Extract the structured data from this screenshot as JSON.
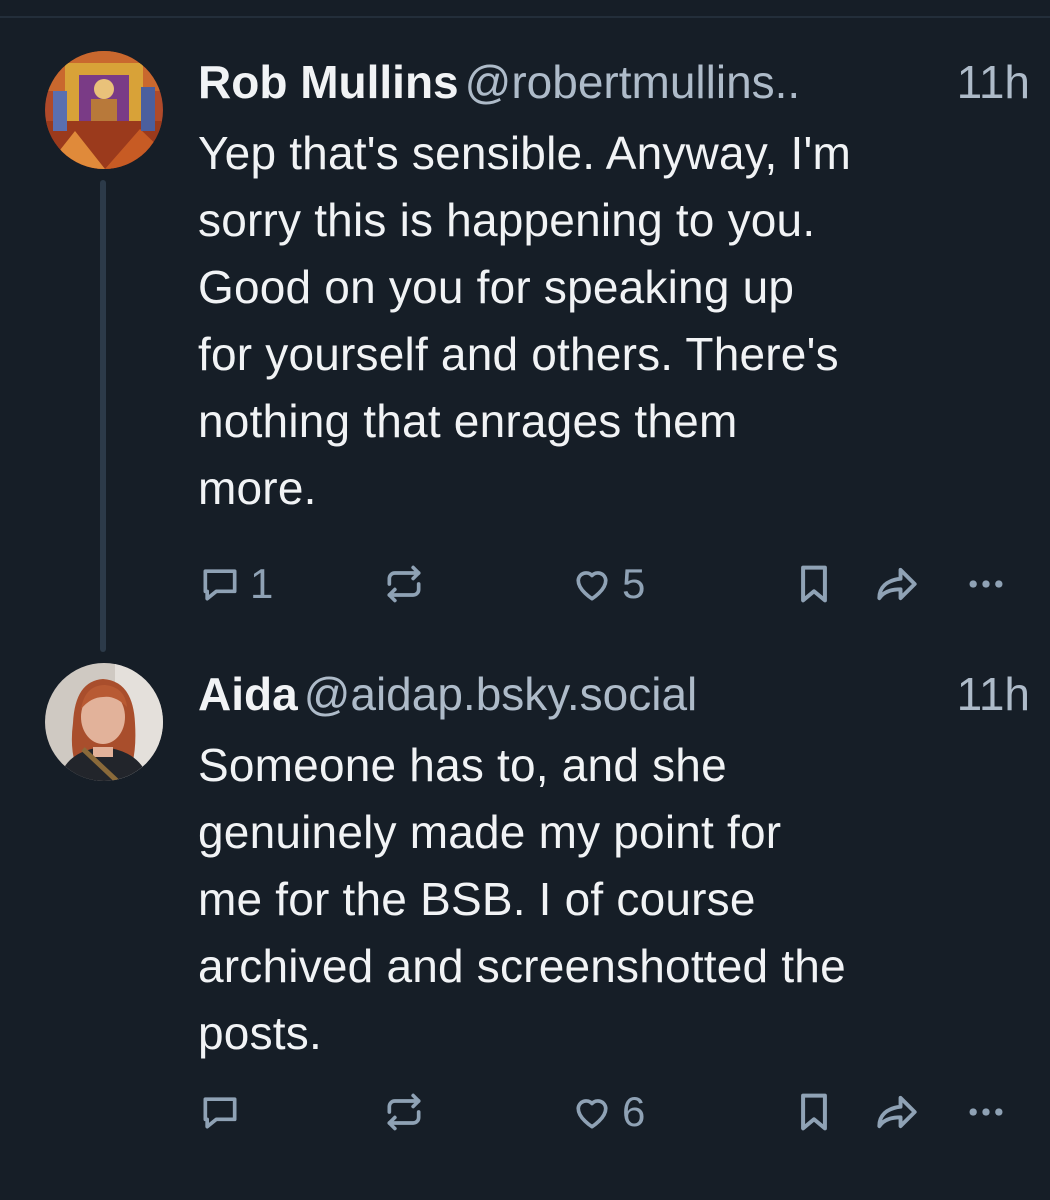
{
  "posts": [
    {
      "display_name": "Rob Mullins",
      "handle": "@robertmullins..",
      "time": "11h",
      "text": "Yep that's sensible. Anyway, I'm\nsorry this is happening to you.\nGood on you for speaking up\nfor yourself and others. There's\nnothing that enrages them\nmore.",
      "reply_count": "1",
      "repost_count": "",
      "like_count": "5",
      "avatar_icon": "painting-avatar"
    },
    {
      "display_name": "Aida",
      "handle": "@aidap.bsky.social",
      "time": "11h",
      "text": "Someone has to, and she\ngenuinely made my point for\nme for the BSB. I of course\narchived and screenshotted the\nposts.",
      "reply_count": "",
      "repost_count": "",
      "like_count": "6",
      "avatar_icon": "photo-avatar"
    }
  ],
  "icons": {
    "reply": "reply-icon",
    "repost": "repost-icon",
    "like": "heart-icon",
    "bookmark": "bookmark-icon",
    "share": "share-icon",
    "more": "more-icon"
  },
  "colors": {
    "background": "#161e27",
    "text": "#f1f3f5",
    "secondary": "#aebbc9",
    "icon": "#8fa2b5",
    "thread_line": "#2c3a49"
  }
}
